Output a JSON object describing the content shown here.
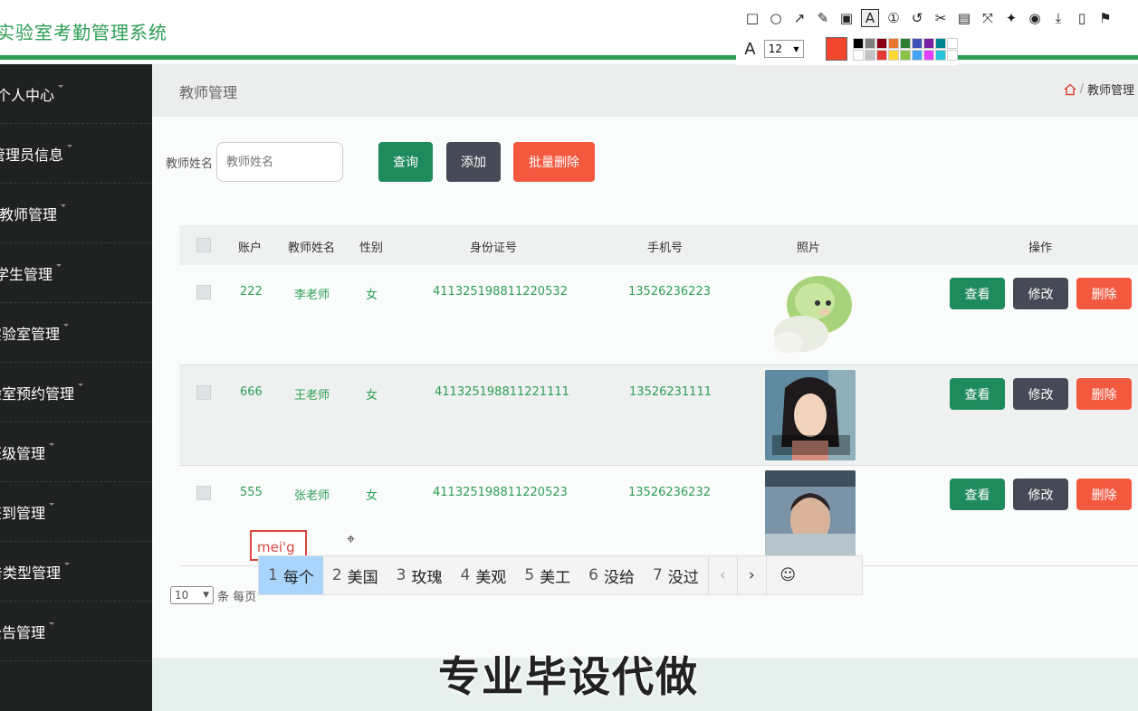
{
  "app": {
    "title": "实验室考勤管理系统"
  },
  "sidebar": {
    "items": [
      {
        "label": "个人中心"
      },
      {
        "label": "管理员信息"
      },
      {
        "label": "教师管理"
      },
      {
        "label": "学生管理"
      },
      {
        "label": "实验室管理"
      },
      {
        "label": "实验室预约管理"
      },
      {
        "label": "班级管理"
      },
      {
        "label": "签到管理"
      },
      {
        "label": "公告类型管理"
      },
      {
        "label": "公告管理"
      }
    ]
  },
  "page": {
    "title": "教师管理",
    "breadcrumb": "教师管理"
  },
  "search": {
    "label": "教师姓名",
    "placeholder": "教师姓名",
    "query_label": "查询",
    "add_label": "添加",
    "batch_delete_label": "批量删除"
  },
  "table": {
    "headers": [
      "账户",
      "教师姓名",
      "性别",
      "身份证号",
      "手机号",
      "照片",
      "操作"
    ],
    "rows": [
      {
        "account": "222",
        "name": "李老师",
        "gender": "女",
        "id_card": "411325198811220532",
        "phone": "13526236223"
      },
      {
        "account": "666",
        "name": "王老师",
        "gender": "女",
        "id_card": "411325198811221111",
        "phone": "13526231111"
      },
      {
        "account": "555",
        "name": "张老师",
        "gender": "女",
        "id_card": "411325198811220523",
        "phone": "13526236232"
      }
    ],
    "view_label": "查看",
    "edit_label": "修改",
    "delete_label": "删除"
  },
  "pager": {
    "page_size": "10",
    "suffix": "条 每页"
  },
  "watermark": "专业毕设代做",
  "annotation_tool": {
    "font_size": "12",
    "current_color": "#f2462f"
  },
  "ime": {
    "input": "mei'g",
    "candidates": [
      {
        "n": "1",
        "text": "每个"
      },
      {
        "n": "2",
        "text": "美国"
      },
      {
        "n": "3",
        "text": "玫瑰"
      },
      {
        "n": "4",
        "text": "美观"
      },
      {
        "n": "5",
        "text": "美工"
      },
      {
        "n": "6",
        "text": "没给"
      },
      {
        "n": "7",
        "text": "没过"
      }
    ]
  }
}
